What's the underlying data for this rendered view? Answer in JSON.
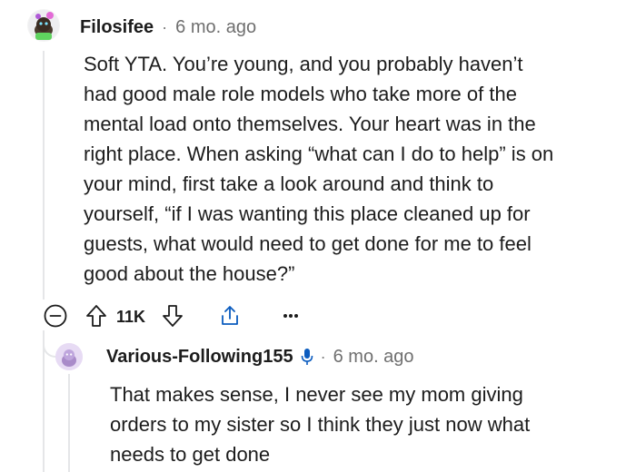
{
  "comment": {
    "username": "Filosifee",
    "separator": "·",
    "age": "6 mo. ago",
    "lines": [
      "Soft YTA. You’re young, and you probably haven’t",
      "had good male role models who take more of the",
      "mental load onto themselves. Your heart was in the",
      "right place. When asking “what can I do to help” is on",
      "your mind, first take a look around and think to",
      "yourself, “if I was wanting this place cleaned up for",
      "guests, what would need to get done for me to feel",
      "good about the house?”"
    ],
    "vote_count": "11K",
    "icons": {
      "collapse": "minus-circle-icon",
      "upvote": "arrow-up-icon",
      "downvote": "arrow-down-icon",
      "share": "share-icon",
      "more": "more-dots-icon"
    }
  },
  "reply": {
    "username": "Various-Following155",
    "separator": "·",
    "age": "6 mo. ago",
    "badge_icon": "microphone-icon",
    "lines": [
      "That makes sense, I never see my mom giving",
      "orders to my sister so I think they just now what",
      "needs to get done"
    ]
  },
  "colors": {
    "text": "#1c1c1c",
    "meta": "#6f6f6f",
    "accent_blue": "#0b5cbf",
    "thread_line": "#e5e6e8"
  }
}
